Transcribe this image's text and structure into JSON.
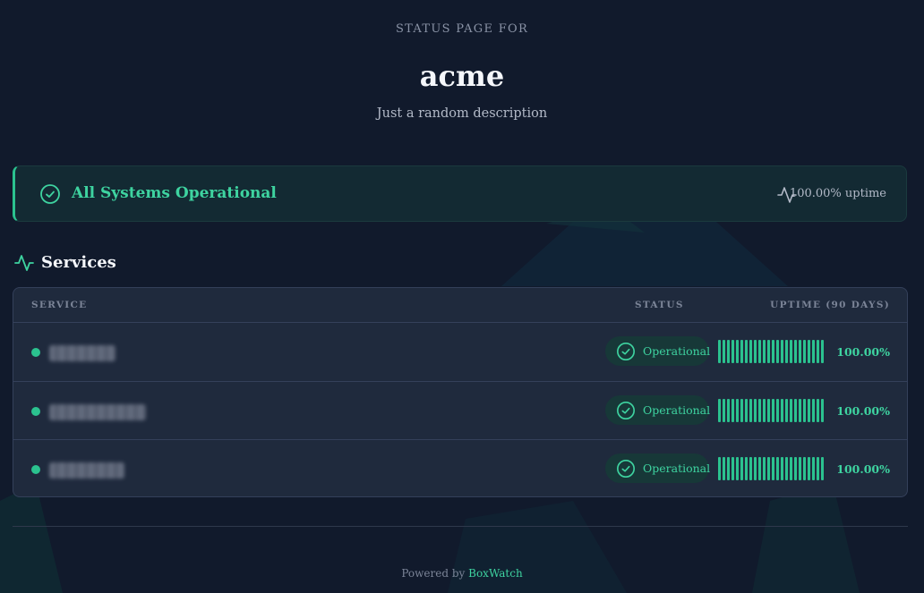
{
  "header": {
    "eyebrow": "STATUS PAGE FOR",
    "title": "acme",
    "description": "Just a random description"
  },
  "banner": {
    "status_text": "All Systems Operational",
    "uptime_text": "100.00% uptime",
    "icon": "check-circle-icon",
    "uptime_icon": "activity-icon"
  },
  "services": {
    "title": "Services",
    "icon": "activity-icon",
    "columns": {
      "service": "SERVICE",
      "status": "STATUS",
      "uptime": "UPTIME (90 DAYS)"
    },
    "rows": [
      {
        "status": "Operational",
        "uptime": "100.00%",
        "history_fraction": 1.0
      },
      {
        "status": "Operational",
        "uptime": "100.00%",
        "history_fraction": 1.0
      },
      {
        "status": "Operational",
        "uptime": "100.00%",
        "history_fraction": 1.0
      }
    ]
  },
  "footer": {
    "prefix": "Powered by",
    "brand": "BoxWatch"
  },
  "colors": {
    "background": "#111a2c",
    "accent": "#3ed3a0",
    "operational": "#2bc28f",
    "card": "#1f2a3d"
  }
}
